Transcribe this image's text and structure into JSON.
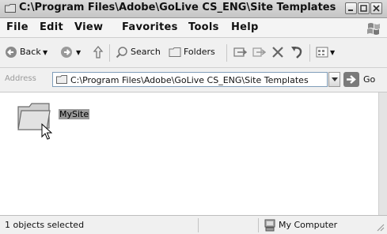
{
  "window": {
    "title": "C:\\Program Files\\Adobe\\GoLive CS_ENG\\Site Templates"
  },
  "menu": {
    "items": [
      "File",
      "Edit",
      "View",
      "Favorites",
      "Tools",
      "Help"
    ]
  },
  "toolbar": {
    "back_label": "Back",
    "search_label": "Search",
    "folders_label": "Folders"
  },
  "address": {
    "label": "Address",
    "path": "C:\\Program Files\\Adobe\\GoLive CS_ENG\\Site Templates",
    "go_label": "Go"
  },
  "files": [
    {
      "name": "MySite",
      "type": "folder",
      "selected": true
    }
  ],
  "status": {
    "left_text": "1 objects selected",
    "right_text": "My Computer"
  },
  "icons": [
    "folder-icon",
    "back-arrow-icon",
    "forward-arrow-icon",
    "up-folder-icon",
    "search-icon",
    "folders-icon",
    "move-to-icon",
    "copy-to-icon",
    "delete-icon",
    "undo-icon",
    "views-icon",
    "go-arrow-icon",
    "computer-icon",
    "windows-logo-icon"
  ]
}
